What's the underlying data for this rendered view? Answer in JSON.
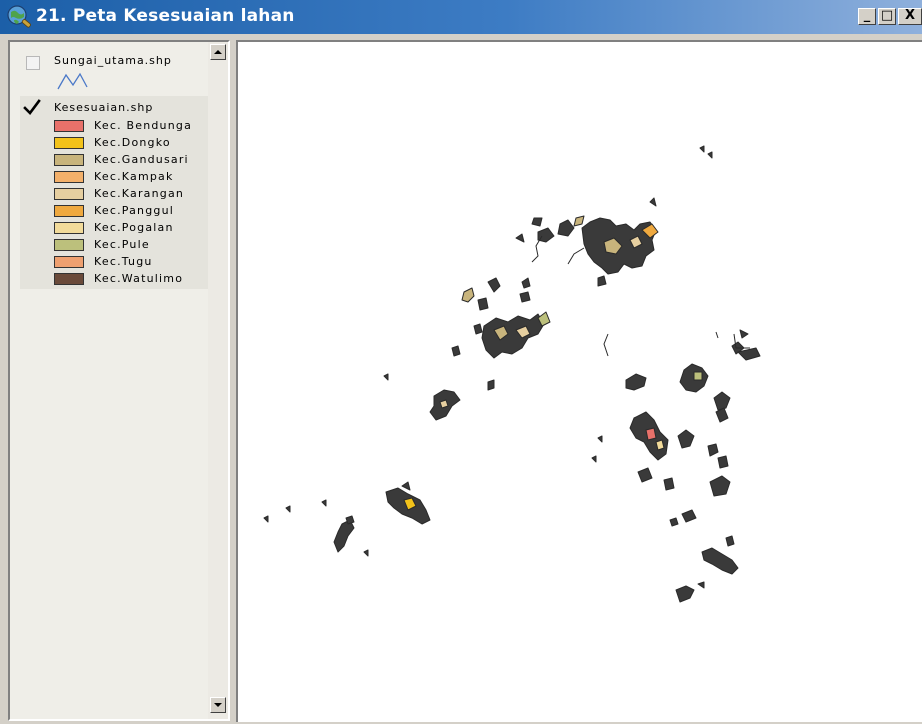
{
  "window": {
    "title": "21. Peta Kesesuaian lahan",
    "buttons": {
      "minimize": "_",
      "maximize": "□",
      "close": "X"
    }
  },
  "toc": {
    "layers": [
      {
        "name": "Sungai_utama.shp",
        "checked": false,
        "symbol": "line-icon",
        "symbol_color": "#4a78c8"
      },
      {
        "name": "Kesesuaian.shp",
        "checked": true
      }
    ],
    "legend": [
      {
        "label": "Kec. Bendunga",
        "color": "#e8716a"
      },
      {
        "label": "Kec.Dongko",
        "color": "#f2c21a"
      },
      {
        "label": "Kec.Gandusari",
        "color": "#c8b47c"
      },
      {
        "label": "Kec.Kampak",
        "color": "#f3b06a"
      },
      {
        "label": "Kec.Karangan",
        "color": "#e6cfa0"
      },
      {
        "label": "Kec.Panggul",
        "color": "#efa93f"
      },
      {
        "label": "Kec.Pogalan",
        "color": "#f2db9a"
      },
      {
        "label": "Kec.Pule",
        "color": "#bcc07c"
      },
      {
        "label": "Kec.Tugu",
        "color": "#eea070"
      },
      {
        "label": "Kec.Watulimo",
        "color": "#6a4a3a"
      }
    ]
  },
  "map": {
    "background": "#ffffff",
    "outline_color": "#2a2a2a",
    "fill_colors": [
      "#3a3a3a",
      "#6a4a3a",
      "#c8b47c",
      "#e6cfa0",
      "#efa93f",
      "#e8716a",
      "#f2c21a",
      "#bcc07c",
      "#eea070",
      "#f2db9a"
    ]
  }
}
